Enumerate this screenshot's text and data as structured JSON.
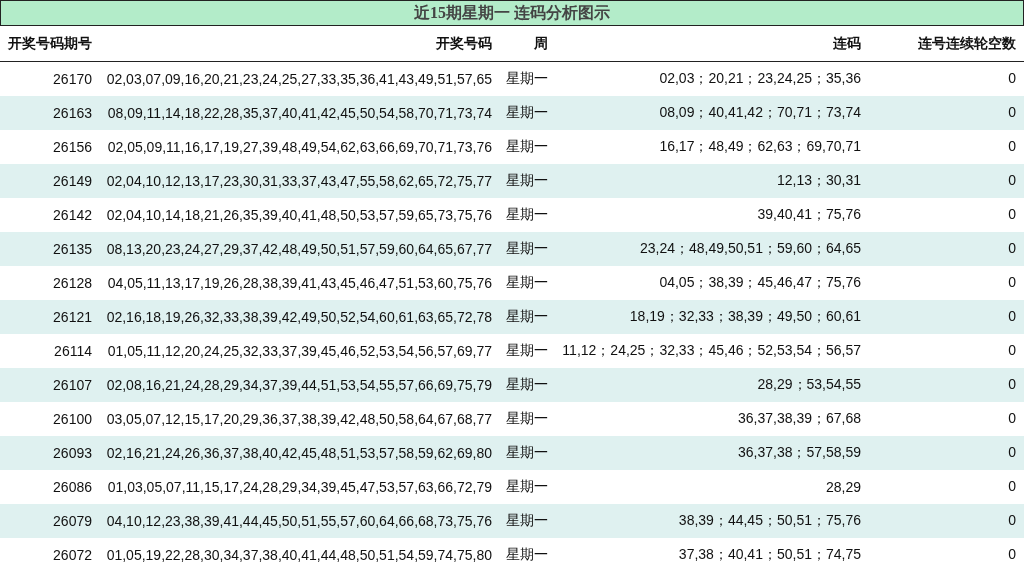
{
  "title": "近15期星期一 连码分析图示",
  "columns": [
    "开奖号码期号",
    "开奖号码",
    "周",
    "连码",
    "连号连续轮空数"
  ],
  "rows": [
    [
      "26170",
      "02,03,07,09,16,20,21,23,24,25,27,33,35,36,41,43,49,51,57,65",
      "星期一",
      "02,03；20,21；23,24,25；35,36",
      "0"
    ],
    [
      "26163",
      "08,09,11,14,18,22,28,35,37,40,41,42,45,50,54,58,70,71,73,74",
      "星期一",
      "08,09；40,41,42；70,71；73,74",
      "0"
    ],
    [
      "26156",
      "02,05,09,11,16,17,19,27,39,48,49,54,62,63,66,69,70,71,73,76",
      "星期一",
      "16,17；48,49；62,63；69,70,71",
      "0"
    ],
    [
      "26149",
      "02,04,10,12,13,17,23,30,31,33,37,43,47,55,58,62,65,72,75,77",
      "星期一",
      "12,13；30,31",
      "0"
    ],
    [
      "26142",
      "02,04,10,14,18,21,26,35,39,40,41,48,50,53,57,59,65,73,75,76",
      "星期一",
      "39,40,41；75,76",
      "0"
    ],
    [
      "26135",
      "08,13,20,23,24,27,29,37,42,48,49,50,51,57,59,60,64,65,67,77",
      "星期一",
      "23,24；48,49,50,51；59,60；64,65",
      "0"
    ],
    [
      "26128",
      "04,05,11,13,17,19,26,28,38,39,41,43,45,46,47,51,53,60,75,76",
      "星期一",
      "04,05；38,39；45,46,47；75,76",
      "0"
    ],
    [
      "26121",
      "02,16,18,19,26,32,33,38,39,42,49,50,52,54,60,61,63,65,72,78",
      "星期一",
      "18,19；32,33；38,39；49,50；60,61",
      "0"
    ],
    [
      "26114",
      "01,05,11,12,20,24,25,32,33,37,39,45,46,52,53,54,56,57,69,77",
      "星期一",
      "11,12；24,25；32,33；45,46；52,53,54；56,57",
      "0"
    ],
    [
      "26107",
      "02,08,16,21,24,28,29,34,37,39,44,51,53,54,55,57,66,69,75,79",
      "星期一",
      "28,29；53,54,55",
      "0"
    ],
    [
      "26100",
      "03,05,07,12,15,17,20,29,36,37,38,39,42,48,50,58,64,67,68,77",
      "星期一",
      "36,37,38,39；67,68",
      "0"
    ],
    [
      "26093",
      "02,16,21,24,26,36,37,38,40,42,45,48,51,53,57,58,59,62,69,80",
      "星期一",
      "36,37,38；57,58,59",
      "0"
    ],
    [
      "26086",
      "01,03,05,07,11,15,17,24,28,29,34,39,45,47,53,57,63,66,72,79",
      "星期一",
      "28,29",
      "0"
    ],
    [
      "26079",
      "04,10,12,23,38,39,41,44,45,50,51,55,57,60,64,66,68,73,75,76",
      "星期一",
      "38,39；44,45；50,51；75,76",
      "0"
    ],
    [
      "26072",
      "01,05,19,22,28,30,34,37,38,40,41,44,48,50,51,54,59,74,75,80",
      "星期一",
      "37,38；40,41；50,51；74,75",
      "0"
    ]
  ]
}
